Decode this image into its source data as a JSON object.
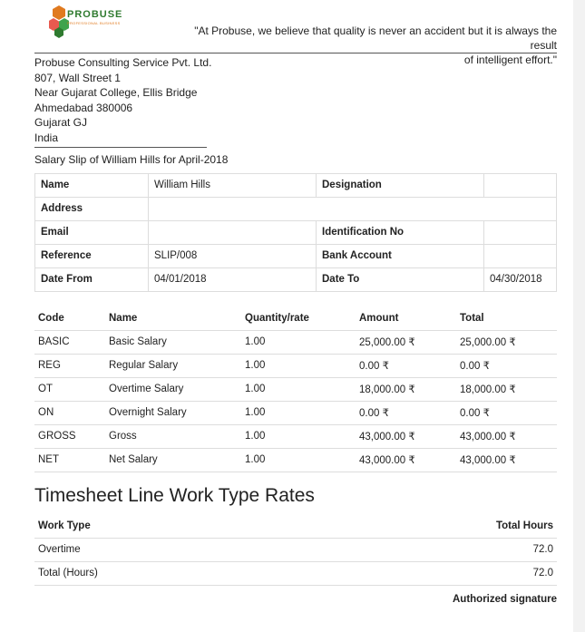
{
  "header": {
    "logo_text": "PROBUSE",
    "logo_sub": "PROFESSIONAL BUSINESS",
    "quote_line1": "\"At Probuse, we believe that quality is never an accident but it is always the result",
    "quote_line2": "of intelligent effort.\""
  },
  "address": [
    "Probuse Consulting Service Pvt. Ltd.",
    "807, Wall Street 1",
    "Near Gujarat College, Ellis Bridge",
    "Ahmedabad 380006",
    "Gujarat GJ",
    "India"
  ],
  "slip_title": "Salary Slip of William Hills for April-2018",
  "employee": {
    "name_label": "Name",
    "name_value": "William Hills",
    "designation_label": "Designation",
    "designation_value": "",
    "address_label": "Address",
    "address_value": "",
    "email_label": "Email",
    "email_value": "",
    "id_label": "Identification No",
    "id_value": "",
    "reference_label": "Reference",
    "reference_value": "SLIP/008",
    "bank_label": "Bank Account",
    "bank_value": "",
    "date_from_label": "Date From",
    "date_from_value": "04/01/2018",
    "date_to_label": "Date To",
    "date_to_value": "04/30/2018"
  },
  "lines": {
    "headers": [
      "Code",
      "Name",
      "Quantity/rate",
      "Amount",
      "Total"
    ],
    "rows": [
      [
        "BASIC",
        "Basic Salary",
        "1.00",
        "25,000.00 ₹",
        "25,000.00 ₹"
      ],
      [
        "REG",
        "Regular Salary",
        "1.00",
        "0.00 ₹",
        "0.00 ₹"
      ],
      [
        "OT",
        "Overtime Salary",
        "1.00",
        "18,000.00 ₹",
        "18,000.00 ₹"
      ],
      [
        "ON",
        "Overnight Salary",
        "1.00",
        "0.00 ₹",
        "0.00 ₹"
      ],
      [
        "GROSS",
        "Gross",
        "1.00",
        "43,000.00 ₹",
        "43,000.00 ₹"
      ],
      [
        "NET",
        "Net Salary",
        "1.00",
        "43,000.00 ₹",
        "43,000.00 ₹"
      ]
    ]
  },
  "timesheet": {
    "title": "Timesheet Line Work Type Rates",
    "headers": [
      "Work Type",
      "Total Hours"
    ],
    "rows": [
      [
        "Overtime",
        "72.0"
      ],
      [
        "Total (Hours)",
        "72.0"
      ]
    ]
  },
  "signature_label": "Authorized signature",
  "colors": {
    "logo_green": "#2f7a2f",
    "logo_orange": "#e07a1f",
    "border": "#dddddd"
  }
}
